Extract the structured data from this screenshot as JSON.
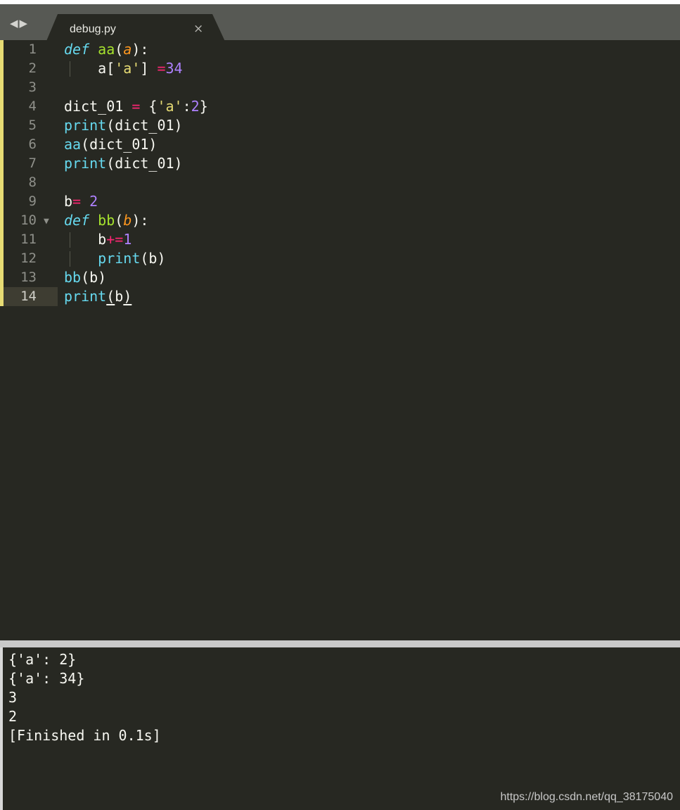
{
  "tab": {
    "filename": "debug.py",
    "close_glyph": "×"
  },
  "nav": {
    "back_glyph": "◀",
    "forward_glyph": "▶"
  },
  "editor": {
    "current_line": 14,
    "lines": [
      {
        "n": "1",
        "tokens": [
          {
            "t": "def",
            "c": "kw"
          },
          {
            "t": " ",
            "c": "txt"
          },
          {
            "t": "aa",
            "c": "fn"
          },
          {
            "t": "(",
            "c": "txt"
          },
          {
            "t": "a",
            "c": "param"
          },
          {
            "t": "):",
            "c": "txt"
          }
        ]
      },
      {
        "n": "2",
        "indent": true,
        "tokens": [
          {
            "t": "    a[",
            "c": "txt"
          },
          {
            "t": "'a'",
            "c": "str"
          },
          {
            "t": "] ",
            "c": "txt"
          },
          {
            "t": "=",
            "c": "op"
          },
          {
            "t": "34",
            "c": "num"
          }
        ]
      },
      {
        "n": "3",
        "tokens": []
      },
      {
        "n": "4",
        "tokens": [
          {
            "t": "dict_01 ",
            "c": "txt"
          },
          {
            "t": "=",
            "c": "op"
          },
          {
            "t": " {",
            "c": "txt"
          },
          {
            "t": "'a'",
            "c": "str"
          },
          {
            "t": ":",
            "c": "txt"
          },
          {
            "t": "2",
            "c": "num"
          },
          {
            "t": "}",
            "c": "txt"
          }
        ]
      },
      {
        "n": "5",
        "tokens": [
          {
            "t": "print",
            "c": "builtin"
          },
          {
            "t": "(dict_01)",
            "c": "txt"
          }
        ]
      },
      {
        "n": "6",
        "tokens": [
          {
            "t": "aa",
            "c": "builtin"
          },
          {
            "t": "(dict_01)",
            "c": "txt"
          }
        ]
      },
      {
        "n": "7",
        "tokens": [
          {
            "t": "print",
            "c": "builtin"
          },
          {
            "t": "(dict_01)",
            "c": "txt"
          }
        ]
      },
      {
        "n": "8",
        "tokens": []
      },
      {
        "n": "9",
        "tokens": [
          {
            "t": "b",
            "c": "txt"
          },
          {
            "t": "=",
            "c": "op"
          },
          {
            "t": " ",
            "c": "txt"
          },
          {
            "t": "2",
            "c": "num"
          }
        ]
      },
      {
        "n": "10",
        "fold": "▼",
        "tokens": [
          {
            "t": "def",
            "c": "kw"
          },
          {
            "t": " ",
            "c": "txt"
          },
          {
            "t": "bb",
            "c": "fn"
          },
          {
            "t": "(",
            "c": "txt"
          },
          {
            "t": "b",
            "c": "param"
          },
          {
            "t": "):",
            "c": "txt"
          }
        ]
      },
      {
        "n": "11",
        "indent": true,
        "tokens": [
          {
            "t": "    b",
            "c": "txt"
          },
          {
            "t": "+=",
            "c": "op"
          },
          {
            "t": "1",
            "c": "num"
          }
        ]
      },
      {
        "n": "12",
        "indent": true,
        "tokens": [
          {
            "t": "    ",
            "c": "txt"
          },
          {
            "t": "print",
            "c": "builtin"
          },
          {
            "t": "(b)",
            "c": "txt"
          }
        ]
      },
      {
        "n": "13",
        "tokens": [
          {
            "t": "bb",
            "c": "builtin"
          },
          {
            "t": "(b)",
            "c": "txt"
          }
        ]
      },
      {
        "n": "14",
        "tokens": [
          {
            "t": "print",
            "c": "builtin"
          },
          {
            "t": "(",
            "c": "ul"
          },
          {
            "t": "b",
            "c": "txt"
          },
          {
            "t": ")",
            "c": "ul"
          }
        ]
      }
    ]
  },
  "output": {
    "lines": [
      "{'a': 2}",
      "{'a': 34}",
      "3",
      "2",
      "[Finished in 0.1s]"
    ]
  },
  "watermark": "https://blog.csdn.net/qq_38175040",
  "colors": {
    "background": "#272822",
    "keyword": "#66d9ef",
    "function": "#a6e22e",
    "parameter": "#fd971f",
    "operator": "#f92672",
    "string": "#e6db74",
    "number": "#ae81ff",
    "modified_marker": "#e6db74"
  }
}
